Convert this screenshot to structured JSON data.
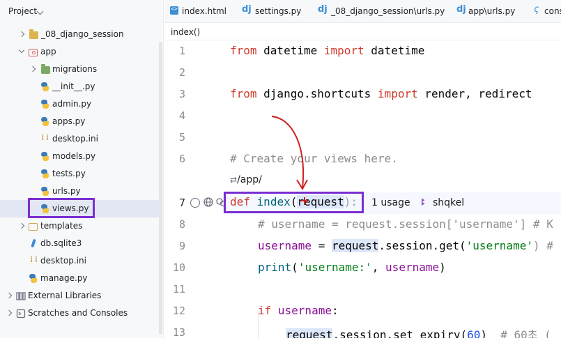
{
  "project_panel": {
    "title": "Project",
    "tree": [
      {
        "label": "_08_django_session",
        "kind": "folder"
      },
      {
        "label": "app",
        "kind": "package"
      },
      {
        "label": "migrations",
        "kind": "folder-green"
      },
      {
        "label": "__init__.py",
        "kind": "python"
      },
      {
        "label": "admin.py",
        "kind": "python"
      },
      {
        "label": "apps.py",
        "kind": "python"
      },
      {
        "label": "desktop.ini",
        "kind": "ini"
      },
      {
        "label": "models.py",
        "kind": "python"
      },
      {
        "label": "tests.py",
        "kind": "python"
      },
      {
        "label": "urls.py",
        "kind": "python"
      },
      {
        "label": "views.py",
        "kind": "python",
        "selected": true
      },
      {
        "label": "templates",
        "kind": "template-folder"
      },
      {
        "label": "db.sqlite3",
        "kind": "database"
      },
      {
        "label": "desktop.ini",
        "kind": "ini"
      },
      {
        "label": "manage.py",
        "kind": "python"
      },
      {
        "label": "External Libraries",
        "kind": "library"
      },
      {
        "label": "Scratches and Consoles",
        "kind": "scratch"
      }
    ]
  },
  "tabs": [
    {
      "label": "index.html",
      "icon": "html-icon"
    },
    {
      "label": "settings.py",
      "icon": "django-icon"
    },
    {
      "label": "_08_django_session\\urls.py",
      "icon": "django-icon"
    },
    {
      "label": "app\\urls.py",
      "icon": "django-icon"
    },
    {
      "label": "cons",
      "icon": "css-icon"
    }
  ],
  "breadcrumb": "index()",
  "editor": {
    "lines": [
      "1",
      "2",
      "3",
      "4",
      "5",
      "6",
      "7",
      "8",
      "9",
      "10",
      "11",
      "12",
      "13"
    ],
    "code": {
      "l1": {
        "a": "from",
        "b": " datetime ",
        "c": "import",
        "d": " datetime"
      },
      "l3": {
        "a": "from",
        "b": " django.shortcuts ",
        "c": "import",
        "d": " render, redirect"
      },
      "l6": "# Create your views here.",
      "url_hint": "/app/",
      "l7": {
        "def": "def",
        "name": "index",
        "open": "(",
        "param": "request",
        "close": "):"
      },
      "l7_usage": "1 usage",
      "l7_author": "shqkel",
      "l8": "# username = request.session['username'] # K",
      "l9": {
        "var": "username",
        "eq": " = ",
        "req": "request",
        "rest": ".session.get(",
        "str": "'username'",
        "end": ") #"
      },
      "l10": {
        "fn": "print",
        "open": "(",
        "str": "'username:'",
        "mid": ", ",
        "var": "username",
        "end": ")"
      },
      "l12": {
        "kw": "if",
        "var": " username",
        "end": ":"
      },
      "l13": {
        "req": "request",
        "rest": ".session.set_expiry(",
        "num": "60",
        "end": ")  ",
        "cm": "# 60초 ("
      }
    }
  },
  "colors": {
    "accent_highlight": "#7b2ed1",
    "annotation_arrow": "#d01f1f",
    "change_marker": "#59a869"
  }
}
